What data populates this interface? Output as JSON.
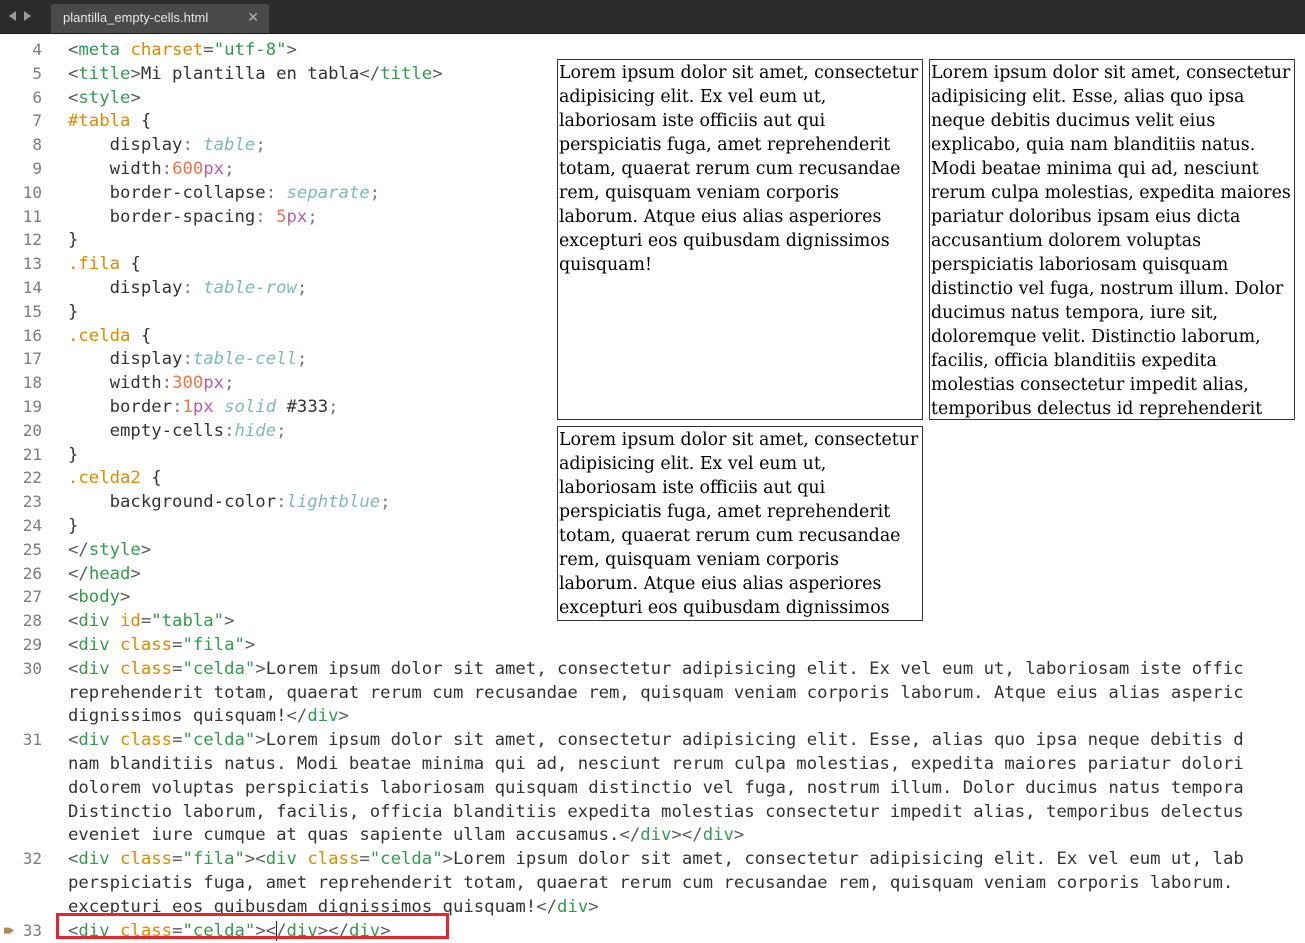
{
  "tab": {
    "title": "plantilla_empty-cells.html"
  },
  "preview": {
    "cell1": "Lorem ipsum dolor sit amet, consectetur adipisicing elit. Ex vel eum ut, laboriosam iste officiis aut qui perspiciatis fuga, amet reprehenderit totam, quaerat rerum cum recusandae rem, quisquam veniam corporis laborum. Atque eius alias asperiores excepturi eos quibusdam dignissimos quisquam!",
    "cell2": "Lorem ipsum dolor sit amet, consectetur adipisicing elit. Esse, alias quo ipsa neque debitis ducimus velit eius explicabo, quia nam blanditiis natus. Modi beatae minima qui ad, nesciunt rerum culpa molestias, expedita maiores pariatur doloribus ipsam eius dicta accusantium dolorem voluptas perspiciatis laboriosam quisquam distinctio vel fuga, nostrum illum. Dolor ducimus natus tempora, iure sit, doloremque velit. Distinctio laborum, facilis, officia blanditiis expedita molestias consectetur impedit alias, temporibus delectus id reprehenderit aspernatur, eveniet iure cumque at quas sapiente ullam accusamus.",
    "cell3": "Lorem ipsum dolor sit amet, consectetur adipisicing elit. Ex vel eum ut, laboriosam iste officiis aut qui perspiciatis fuga, amet reprehenderit totam, quaerat rerum cum recusandae rem, quisquam veniam corporis laborum. Atque eius alias asperiores excepturi eos quibusdam dignissimos quisquam!"
  },
  "code": {
    "lines": [
      {
        "n": "4",
        "segs": [
          [
            "t-br",
            "<"
          ],
          [
            "t-tag",
            "meta"
          ],
          [
            "",
            "&nbsp;"
          ],
          [
            "t-attr",
            "charset"
          ],
          [
            "t-br",
            "="
          ],
          [
            "t-str",
            "\"utf-8\""
          ],
          [
            "t-br",
            ">"
          ]
        ]
      },
      {
        "n": "5",
        "segs": [
          [
            "t-br",
            "<"
          ],
          [
            "t-tag",
            "title"
          ],
          [
            "t-br",
            ">"
          ],
          [
            "",
            "Mi plantilla en tabla"
          ],
          [
            "t-br",
            "</"
          ],
          [
            "t-tag",
            "title"
          ],
          [
            "t-br",
            ">"
          ]
        ]
      },
      {
        "n": "6",
        "segs": [
          [
            "t-br",
            "<"
          ],
          [
            "t-tag",
            "style"
          ],
          [
            "t-br",
            ">"
          ]
        ]
      },
      {
        "n": "7",
        "segs": [
          [
            "t-sel",
            "#tabla"
          ],
          [
            "",
            " {"
          ]
        ]
      },
      {
        "n": "8",
        "segs": [
          [
            "",
            "    "
          ],
          [
            "t-prop",
            "display"
          ],
          [
            "t-punct",
            ": "
          ],
          [
            "t-kw",
            "table"
          ],
          [
            "t-punct",
            ";"
          ]
        ]
      },
      {
        "n": "9",
        "segs": [
          [
            "",
            "    "
          ],
          [
            "t-prop",
            "width"
          ],
          [
            "t-punct",
            ":"
          ],
          [
            "t-num",
            "600"
          ],
          [
            "t-unit",
            "px"
          ],
          [
            "t-punct",
            ";"
          ]
        ]
      },
      {
        "n": "10",
        "segs": [
          [
            "",
            "    "
          ],
          [
            "t-prop",
            "border-collapse"
          ],
          [
            "t-punct",
            ": "
          ],
          [
            "t-kw",
            "separate"
          ],
          [
            "t-punct",
            ";"
          ]
        ]
      },
      {
        "n": "11",
        "segs": [
          [
            "",
            "    "
          ],
          [
            "t-prop",
            "border-spacing"
          ],
          [
            "t-punct",
            ": "
          ],
          [
            "t-num",
            "5"
          ],
          [
            "t-unit",
            "px"
          ],
          [
            "t-punct",
            ";"
          ]
        ]
      },
      {
        "n": "12",
        "segs": [
          [
            "",
            "}"
          ]
        ]
      },
      {
        "n": "13",
        "segs": [
          [
            "t-sel",
            ".fila"
          ],
          [
            "",
            " {"
          ]
        ]
      },
      {
        "n": "14",
        "segs": [
          [
            "",
            "    "
          ],
          [
            "t-prop",
            "display"
          ],
          [
            "t-punct",
            ": "
          ],
          [
            "t-kw",
            "table-row"
          ],
          [
            "t-punct",
            ";"
          ]
        ]
      },
      {
        "n": "15",
        "segs": [
          [
            "",
            "}"
          ]
        ]
      },
      {
        "n": "16",
        "segs": [
          [
            "t-sel",
            ".celda"
          ],
          [
            "",
            " {"
          ]
        ]
      },
      {
        "n": "17",
        "segs": [
          [
            "",
            "    "
          ],
          [
            "t-prop",
            "display"
          ],
          [
            "t-punct",
            ":"
          ],
          [
            "t-kw",
            "table-cell"
          ],
          [
            "t-punct",
            ";"
          ]
        ]
      },
      {
        "n": "18",
        "segs": [
          [
            "",
            "    "
          ],
          [
            "t-prop",
            "width"
          ],
          [
            "t-punct",
            ":"
          ],
          [
            "t-num",
            "300"
          ],
          [
            "t-unit",
            "px"
          ],
          [
            "t-punct",
            ";"
          ]
        ]
      },
      {
        "n": "19",
        "segs": [
          [
            "",
            "    "
          ],
          [
            "t-prop",
            "border"
          ],
          [
            "t-punct",
            ":"
          ],
          [
            "t-num",
            "1"
          ],
          [
            "t-unit",
            "px"
          ],
          [
            "",
            ""
          ],
          [
            "t-kw",
            " solid"
          ],
          [
            "",
            " #333"
          ],
          [
            "t-punct",
            ";"
          ]
        ]
      },
      {
        "n": "20",
        "segs": [
          [
            "",
            "    "
          ],
          [
            "t-prop",
            "empty-cells"
          ],
          [
            "t-punct",
            ":"
          ],
          [
            "t-kw",
            "hide"
          ],
          [
            "t-punct",
            ";"
          ]
        ]
      },
      {
        "n": "21",
        "segs": [
          [
            "",
            "}"
          ]
        ]
      },
      {
        "n": "22",
        "segs": [
          [
            "t-sel",
            ".celda2"
          ],
          [
            "",
            " {"
          ]
        ]
      },
      {
        "n": "23",
        "segs": [
          [
            "",
            "    "
          ],
          [
            "t-prop",
            "background-color"
          ],
          [
            "t-punct",
            ":"
          ],
          [
            "t-kw",
            "lightblue"
          ],
          [
            "t-punct",
            ";"
          ]
        ]
      },
      {
        "n": "24",
        "segs": [
          [
            "",
            "}"
          ]
        ]
      },
      {
        "n": "25",
        "segs": [
          [
            "t-br",
            "</"
          ],
          [
            "t-tag",
            "style"
          ],
          [
            "t-br",
            ">"
          ]
        ]
      },
      {
        "n": "26",
        "segs": [
          [
            "t-br",
            "</"
          ],
          [
            "t-tag",
            "head"
          ],
          [
            "t-br",
            ">"
          ]
        ]
      },
      {
        "n": "27",
        "segs": [
          [
            "t-br",
            "<"
          ],
          [
            "t-tag",
            "body"
          ],
          [
            "t-br",
            ">"
          ]
        ]
      },
      {
        "n": "28",
        "segs": [
          [
            "t-br",
            "<"
          ],
          [
            "t-tag",
            "div"
          ],
          [
            "",
            " "
          ],
          [
            "t-attr",
            "id"
          ],
          [
            "t-br",
            "="
          ],
          [
            "t-str",
            "\"tabla\""
          ],
          [
            "t-br",
            ">"
          ]
        ]
      },
      {
        "n": "29",
        "segs": [
          [
            "t-br",
            "<"
          ],
          [
            "t-tag",
            "div"
          ],
          [
            "",
            " "
          ],
          [
            "t-attr",
            "class"
          ],
          [
            "t-br",
            "="
          ],
          [
            "t-str",
            "\"fila\""
          ],
          [
            "t-br",
            ">"
          ]
        ]
      }
    ],
    "wrapped": [
      {
        "n": "30",
        "rows": [
          [
            [
              "t-br",
              "<"
            ],
            [
              "t-tag",
              "div"
            ],
            [
              "",
              " "
            ],
            [
              "t-attr",
              "class"
            ],
            [
              "t-br",
              "="
            ],
            [
              "t-str",
              "\"celda\""
            ],
            [
              "t-br",
              ">"
            ],
            [
              "",
              "Lorem ipsum dolor sit amet, consectetur adipisicing elit. Ex vel eum ut, laboriosam iste offic"
            ]
          ],
          [
            [
              "",
              "reprehenderit totam, quaerat rerum cum recusandae rem, quisquam veniam corporis laborum. Atque eius alias asperic"
            ]
          ],
          [
            [
              "",
              "dignissimos quisquam!"
            ],
            [
              "t-br",
              "</"
            ],
            [
              "t-tag",
              "div"
            ],
            [
              "t-br",
              ">"
            ]
          ]
        ]
      },
      {
        "n": "31",
        "rows": [
          [
            [
              "t-br",
              "<"
            ],
            [
              "t-tag",
              "div"
            ],
            [
              "",
              " "
            ],
            [
              "t-attr",
              "class"
            ],
            [
              "t-br",
              "="
            ],
            [
              "t-str",
              "\"celda\""
            ],
            [
              "t-br",
              ">"
            ],
            [
              "",
              "Lorem ipsum dolor sit amet, consectetur adipisicing elit. Esse, alias quo ipsa neque debitis d"
            ]
          ],
          [
            [
              "",
              "nam blanditiis natus. Modi beatae minima qui ad, nesciunt rerum culpa molestias, expedita maiores pariatur dolori"
            ]
          ],
          [
            [
              "",
              "dolorem voluptas perspiciatis laboriosam quisquam distinctio vel fuga, nostrum illum. Dolor ducimus natus tempora"
            ]
          ],
          [
            [
              "",
              "Distinctio laborum, facilis, officia blanditiis expedita molestias consectetur impedit alias, temporibus delectus"
            ]
          ],
          [
            [
              "",
              "eveniet iure cumque at quas sapiente ullam accusamus."
            ],
            [
              "t-br",
              "</"
            ],
            [
              "t-tag",
              "div"
            ],
            [
              "t-br",
              "></"
            ],
            [
              "t-tag",
              "div"
            ],
            [
              "t-br",
              ">"
            ]
          ]
        ]
      },
      {
        "n": "32",
        "rows": [
          [
            [
              "t-br",
              "<"
            ],
            [
              "t-tag",
              "div"
            ],
            [
              "",
              " "
            ],
            [
              "t-attr",
              "class"
            ],
            [
              "t-br",
              "="
            ],
            [
              "t-str",
              "\"fila\""
            ],
            [
              "t-br",
              "><"
            ],
            [
              "t-tag",
              "div"
            ],
            [
              "",
              " "
            ],
            [
              "t-attr",
              "class"
            ],
            [
              "t-br",
              "="
            ],
            [
              "t-str",
              "\"celda\""
            ],
            [
              "t-br",
              ">"
            ],
            [
              "",
              "Lorem ipsum dolor sit amet, consectetur adipisicing elit. Ex vel eum ut, lab"
            ]
          ],
          [
            [
              "",
              "perspiciatis fuga, amet reprehenderit totam, quaerat rerum cum recusandae rem, quisquam veniam corporis laborum. "
            ]
          ],
          [
            [
              "",
              "excepturi eos quibusdam dignissimos quisquam!"
            ],
            [
              "t-br",
              "</"
            ],
            [
              "t-tag",
              "div"
            ],
            [
              "t-br",
              ">"
            ]
          ]
        ]
      },
      {
        "n": "33",
        "rows": [
          [
            [
              "t-br",
              "<"
            ],
            [
              "t-tag",
              "div"
            ],
            [
              "",
              " "
            ],
            [
              "t-attr",
              "class"
            ],
            [
              "t-br",
              "="
            ],
            [
              "t-str",
              "\"celda\""
            ],
            [
              "t-br",
              ">"
            ],
            [
              "t-br",
              "</"
            ],
            [
              "t-tag",
              "div"
            ],
            [
              "t-br",
              "></"
            ],
            [
              "t-tag",
              "div"
            ],
            [
              "t-br",
              ">"
            ]
          ]
        ]
      }
    ]
  }
}
